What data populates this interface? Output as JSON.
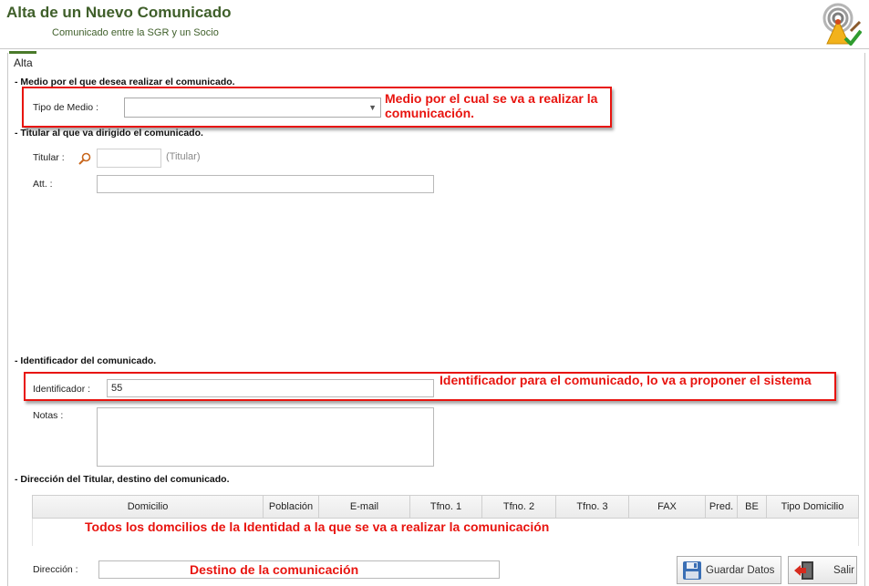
{
  "header": {
    "title": "Alta de un Nuevo Comunicado",
    "subtitle": "Comunicado entre la SGR y un Socio"
  },
  "panel": {
    "title": "Alta"
  },
  "medio": {
    "section_title": "- Medio por el que desea realizar el comunicado.",
    "tipo_label": "Tipo de Medio :",
    "tipo_value": ""
  },
  "titular": {
    "section_title": "- Titular al que va dirigido el comunicado.",
    "titular_label": "Titular :",
    "titular_value": "",
    "titular_hint": "(Titular)",
    "att_label": "Att. :",
    "att_value": ""
  },
  "identificador": {
    "section_title": "- Identificador del comunicado.",
    "label": "Identificador :",
    "value": "55",
    "notas_label": "Notas :",
    "notas_value": ""
  },
  "direccion": {
    "section_title": "- Dirección del Titular, destino del comunicado.",
    "columns": [
      "Domicilio",
      "Población",
      "E-mail",
      "Tfno. 1",
      "Tfno. 2",
      "Tfno. 3",
      "FAX",
      "Pred.",
      "BE",
      "Tipo Domicilio"
    ],
    "label": "Dirección :",
    "value": ""
  },
  "annotations": {
    "medio": "Medio por el cual se va a realizar la comunicación.",
    "identificador": "Identificador para el comunicado, lo va a proponer el sistema",
    "domicilios": "Todos los domcilios de la Identidad a la que se va a realizar la comunicación",
    "destino": "Destino de la comunicación"
  },
  "buttons": {
    "save": "Guardar Datos",
    "exit": "Salir"
  },
  "colors": {
    "header_text": "#3f5f2a",
    "annotation": "#e8140f"
  }
}
